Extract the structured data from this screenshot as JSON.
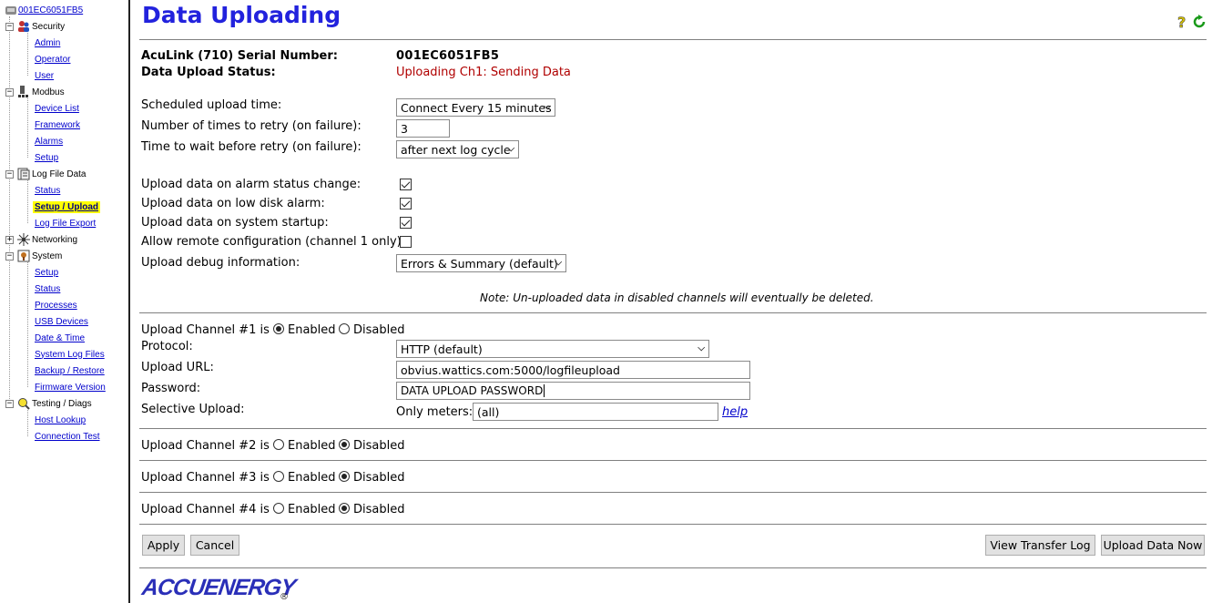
{
  "sidebar": {
    "root": "001EC6051FB5",
    "groups": [
      {
        "label": "Security",
        "items": [
          "Admin",
          "Operator",
          "User"
        ]
      },
      {
        "label": "Modbus",
        "items": [
          "Device List",
          "Framework",
          "Alarms",
          "Setup"
        ]
      },
      {
        "label": "Log File Data",
        "items": [
          "Status",
          "Setup / Upload",
          "Log File Export"
        ]
      },
      {
        "label": "Networking",
        "items": []
      },
      {
        "label": "System",
        "items": [
          "Setup",
          "Status",
          "Processes",
          "USB Devices",
          "Date & Time",
          "System Log Files",
          "Backup / Restore",
          "Firmware Version"
        ]
      },
      {
        "label": "Testing / Diags",
        "items": [
          "Host Lookup",
          "Connection Test"
        ]
      }
    ],
    "selected": "Setup / Upload"
  },
  "page": {
    "title": "Data Uploading",
    "serial_label": "AcuLink (710) Serial Number:",
    "serial_value": "001EC6051FB5",
    "status_label": "Data Upload Status:",
    "status_value": "Uploading Ch1: Sending Data"
  },
  "schedule": {
    "upload_time_label": "Scheduled upload time:",
    "upload_time_value": "Connect Every 15 minutes",
    "retry_label": "Number of times to retry (on failure):",
    "retry_value": "3",
    "wait_label": "Time to wait before retry (on failure):",
    "wait_value": "after next log cycle"
  },
  "options": {
    "alarm_label": "Upload data on alarm status change:",
    "alarm_checked": true,
    "disk_label": "Upload data on low disk alarm:",
    "disk_checked": true,
    "startup_label": "Upload data on system startup:",
    "startup_checked": true,
    "remote_label": "Allow remote configuration (channel 1 only):",
    "remote_checked": false,
    "debug_label": "Upload debug information:",
    "debug_value": "Errors & Summary (default)"
  },
  "note": "Note: Un-uploaded data in disabled channels will eventually be deleted.",
  "channel1": {
    "label": "Upload Channel #1 is",
    "enabled_label": "Enabled",
    "disabled_label": "Disabled",
    "enabled": true,
    "protocol_label": "Protocol:",
    "protocol_value": "HTTP (default)",
    "url_label": "Upload URL:",
    "url_value": "obvius.wattics.com:5000/logfileupload",
    "password_label": "Password:",
    "password_value": "DATA UPLOAD PASSWORD",
    "selective_label": "Selective Upload:",
    "only_meters_label": "Only meters:",
    "only_meters_value": "(all)",
    "help_label": "help"
  },
  "channels": [
    {
      "label": "Upload Channel #2 is",
      "enabled_label": "Enabled",
      "disabled_label": "Disabled",
      "enabled": false
    },
    {
      "label": "Upload Channel #3 is",
      "enabled_label": "Enabled",
      "disabled_label": "Disabled",
      "enabled": false
    },
    {
      "label": "Upload Channel #4 is",
      "enabled_label": "Enabled",
      "disabled_label": "Disabled",
      "enabled": false
    }
  ],
  "buttons": {
    "apply": "Apply",
    "cancel": "Cancel",
    "view_log": "View Transfer Log",
    "upload_now": "Upload Data Now"
  },
  "footer": {
    "logo": "ACCUENERGY",
    "reg": "®"
  },
  "colors": {
    "title": "#2222dd",
    "status": "#b00000",
    "selected_bg": "#ffff00"
  },
  "icons": [
    "help-icon",
    "refresh-icon"
  ]
}
